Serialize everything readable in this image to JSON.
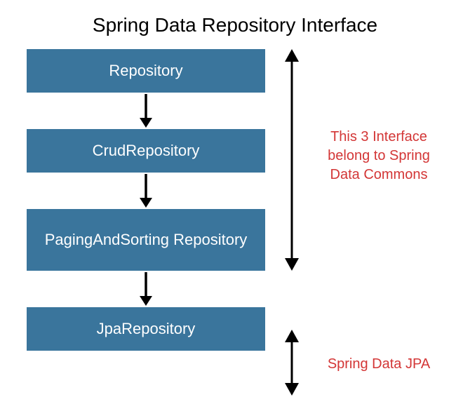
{
  "title": "Spring Data Repository Interface",
  "boxes": [
    {
      "label": "Repository"
    },
    {
      "label": "CrudRepository"
    },
    {
      "label": "PagingAndSorting Repository"
    },
    {
      "label": "JpaRepository"
    }
  ],
  "annotations": {
    "top": "This 3 Interface belong to Spring Data Commons",
    "bottom": "Spring Data JPA"
  },
  "colors": {
    "box_bg": "#3a759c",
    "annotation_text": "#d33636"
  }
}
